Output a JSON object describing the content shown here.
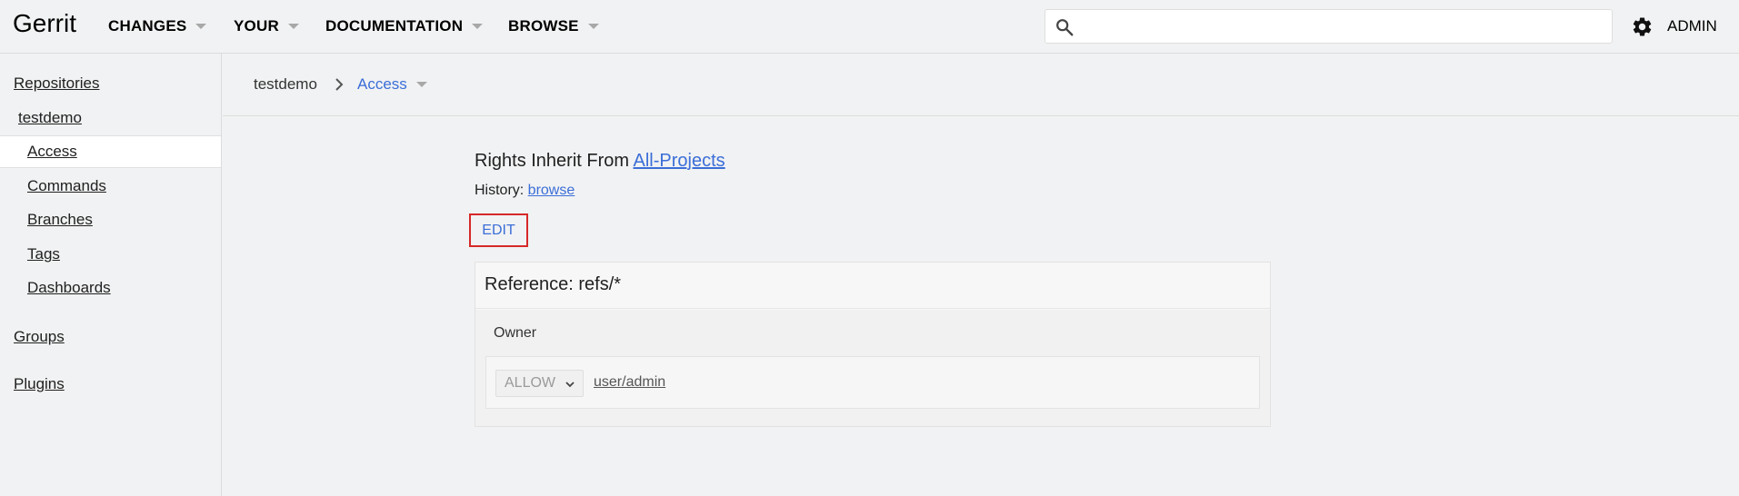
{
  "header": {
    "logo": "Gerrit",
    "menus": [
      {
        "label": "CHANGES"
      },
      {
        "label": "YOUR"
      },
      {
        "label": "DOCUMENTATION"
      },
      {
        "label": "BROWSE"
      }
    ],
    "search": {
      "value": "",
      "placeholder": ""
    },
    "user_label": "ADMIN"
  },
  "sidebar": {
    "repositories": "Repositories",
    "project": "testdemo",
    "items": [
      {
        "label": "Access"
      },
      {
        "label": "Commands"
      },
      {
        "label": "Branches"
      },
      {
        "label": "Tags"
      },
      {
        "label": "Dashboards"
      }
    ],
    "groups": "Groups",
    "plugins": "Plugins"
  },
  "breadcrumb": {
    "project": "testdemo",
    "current": "Access"
  },
  "access": {
    "inherit_prefix": "Rights Inherit From ",
    "inherit_link": "All-Projects",
    "history_prefix": "History: ",
    "history_link": "browse",
    "edit_label": "EDIT",
    "reference_title": "Reference: refs/*",
    "permission_name": "Owner",
    "rule_action": "ALLOW",
    "rule_group": "user/admin"
  },
  "colors": {
    "link": "#3b6ed8",
    "edit_highlight": "#d62828",
    "background": "#f1f2f3"
  }
}
